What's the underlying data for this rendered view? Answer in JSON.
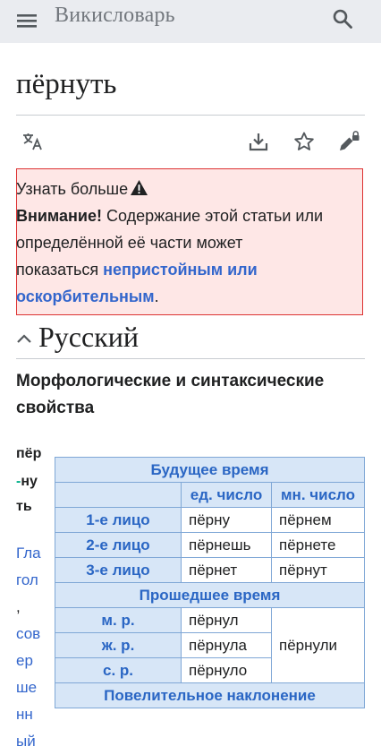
{
  "header": {
    "title": "Викисловарь",
    "menu_icon": "hamburger-menu-icon",
    "search_icon": "search-icon"
  },
  "page": {
    "title": "пёрнуть"
  },
  "toolbar": {
    "icons": [
      "language-icon",
      "download-icon",
      "star-icon",
      "edit-lock-icon"
    ]
  },
  "notice": {
    "learn_more": "Узнать больше",
    "warning_bold": "Внимание!",
    "text1": " Содержание этой статьи или",
    "text2": "определённой её части может",
    "text3": "показаться ",
    "link1": "непристойным или",
    "link2": "оскорбительным",
    "end": ".",
    "colors": {
      "background": "#fee7e6",
      "border": "#dd3333",
      "link": "#3366cc"
    }
  },
  "section": {
    "title": "Русский"
  },
  "morph": {
    "heading": "Морфологические и синтаксические свойства"
  },
  "syllables": {
    "s1": "пёр",
    "dash": "-",
    "s2": "ну",
    "s3": "ть"
  },
  "pos_lines": [
    "Гла",
    "гол",
    ",",
    "сов",
    "ер",
    "ше",
    "нн",
    "ый"
  ],
  "table": {
    "future": "Будущее время",
    "sg": "ед. число",
    "pl": "мн. число",
    "rows": [
      {
        "person": "1-е лицо",
        "sg": "пёрну",
        "pl": "пёрнем"
      },
      {
        "person": "2-е лицо",
        "sg": "пёрнешь",
        "pl": "пёрнете"
      },
      {
        "person": "3-е лицо",
        "sg": "пёрнет",
        "pl": "пёрнут"
      }
    ],
    "past": "Прошедшее время",
    "m": "м. р.",
    "m_val": "пёрнул",
    "f": "ж. р.",
    "f_val": "пёрнула",
    "n": "с. р.",
    "n_val": "пёрнуло",
    "past_pl": "пёрнули",
    "imperative": "Повелительное наклонение"
  },
  "colors": {
    "header_bg": "#eaecf0",
    "table_header_bg": "#d7e6f7",
    "table_border": "#7fa7d6",
    "table_header_text": "#2a66c4"
  }
}
